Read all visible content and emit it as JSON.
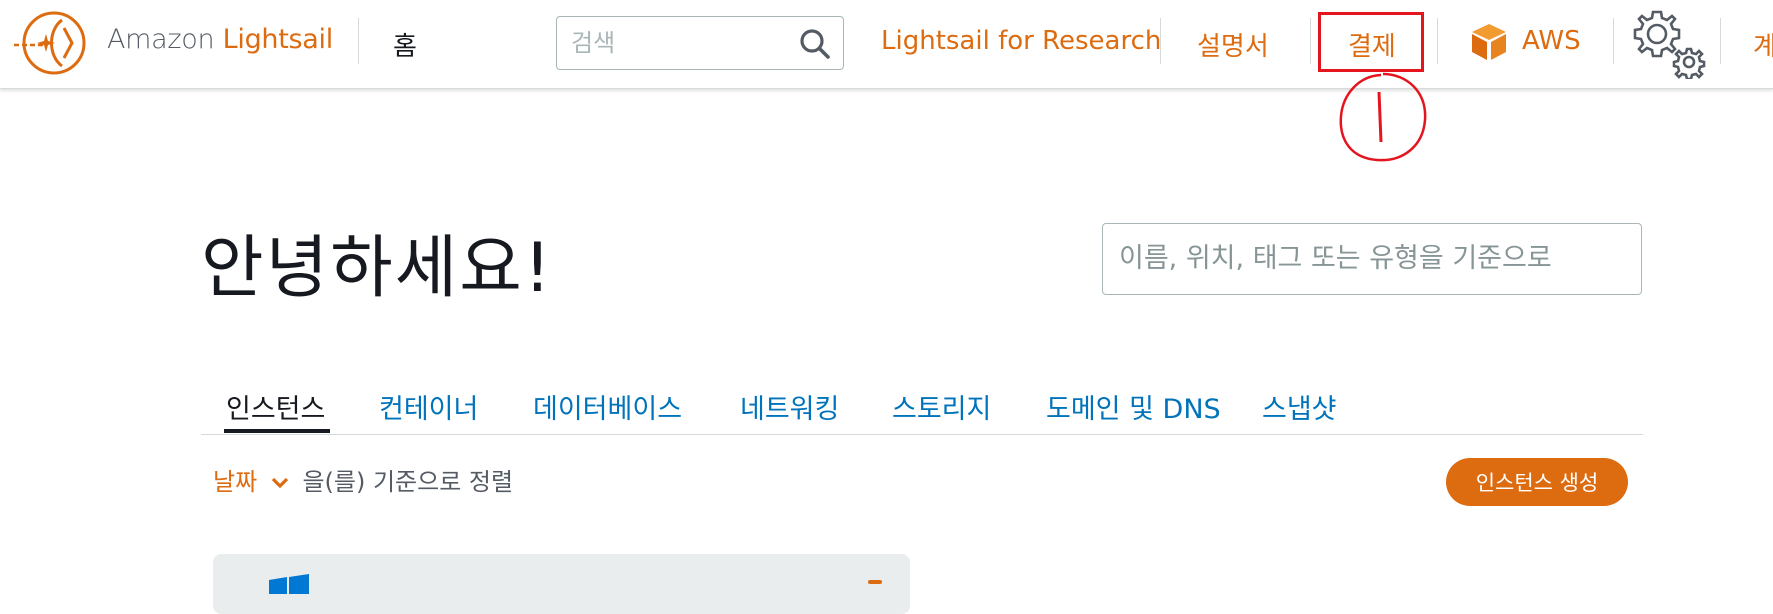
{
  "header": {
    "brand_part1": "Amazon",
    "brand_part2": "Lightsail",
    "home": "홈",
    "search_placeholder": "검색",
    "research_link": "Lightsail for Research",
    "docs_link": "설명서",
    "billing_link": "결제",
    "aws_link": "AWS",
    "edge_partial": "계",
    "icons": [
      "lightsail-logo-icon",
      "search-icon",
      "aws-cube-icon",
      "gear-icon"
    ]
  },
  "annotation": {
    "box_color": "#e4151f",
    "mark": "1"
  },
  "main": {
    "greeting": "안녕하세요!",
    "filter_placeholder": "이름, 위치, 태그 또는 유형을 기준으로",
    "tabs": [
      "인스턴스",
      "컨테이너",
      "데이터베이스",
      "네트워킹",
      "스토리지",
      "도메인 및 DNS",
      "스냅샷"
    ],
    "active_tab": "인스턴스",
    "sort_field": "날짜",
    "sort_suffix": "을(를) 기준으로 정렬",
    "create_button": "인스턴스 생성",
    "first_card_icon": "windows-logo-icon"
  },
  "colors": {
    "accent": "#dd6b10",
    "link": "#0073bb",
    "text": "#16191f",
    "annotation": "#e4151f"
  }
}
